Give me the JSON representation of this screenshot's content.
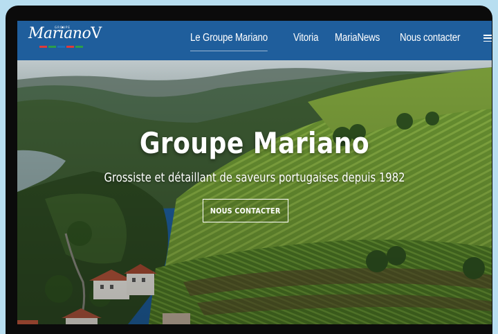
{
  "logo": {
    "groupe": "GROUPE",
    "name": "Mariano",
    "initial": "V",
    "flag_colors": [
      "#e03a3a",
      "#2b9f4a",
      "#1d6fb8",
      "#e03a3a",
      "#2b9f4a"
    ]
  },
  "nav": {
    "items": [
      {
        "label": "Le Groupe Mariano",
        "active": true
      },
      {
        "label": "Vitoria",
        "active": false
      },
      {
        "label": "MariaNews",
        "active": false
      },
      {
        "label": "Nous contacter",
        "active": false
      }
    ],
    "menu_icon": "hamburger-icon"
  },
  "hero": {
    "title": "Groupe Mariano",
    "subtitle": "Grossiste et détaillant de saveurs portugaises depuis 1982",
    "cta_label": "NOUS CONTACTER"
  },
  "colors": {
    "header_bg": "#1f5e9c",
    "page_bg": "#b8def0",
    "frame": "#0b0b0b"
  }
}
